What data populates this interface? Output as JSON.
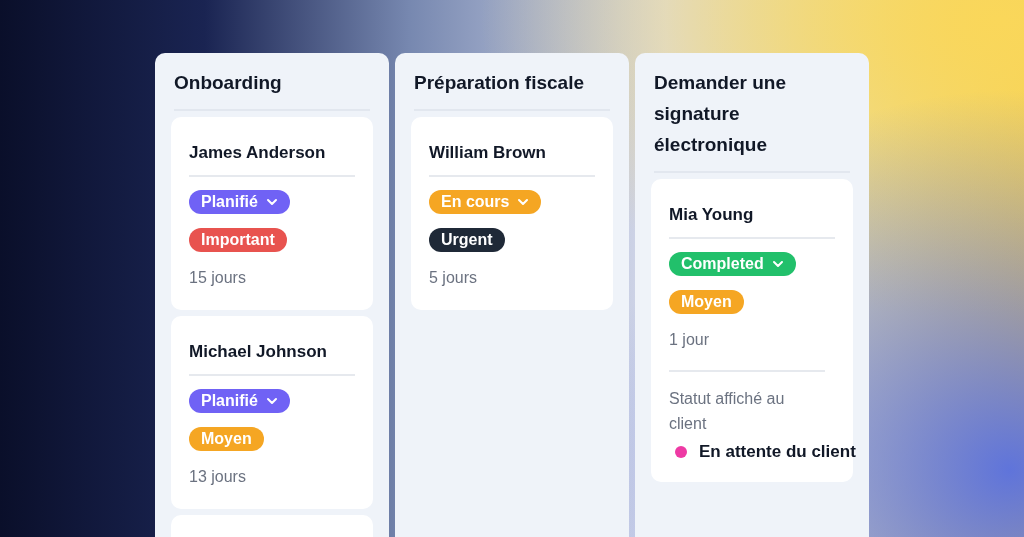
{
  "columns": [
    {
      "title": "Onboarding",
      "cards": [
        {
          "kind": "full",
          "name": "James Anderson",
          "status": {
            "label": "Planifié",
            "color": "#7062f5"
          },
          "priority": {
            "label": "Important",
            "color": "#e8534f"
          },
          "duration": "15 jours"
        },
        {
          "kind": "full",
          "name": "Michael Johnson",
          "status": {
            "label": "Planifié",
            "color": "#7062f5"
          },
          "priority": {
            "label": "Moyen",
            "color": "#f5a623"
          },
          "duration": "13 jours"
        },
        {
          "kind": "cut-off"
        }
      ]
    },
    {
      "title": "Préparation fiscale",
      "cards": [
        {
          "kind": "full",
          "name": "William Brown",
          "status": {
            "label": "En cours",
            "color": "#f5a623"
          },
          "priority": {
            "label": "Urgent",
            "color": "#1f2937"
          },
          "duration": "5 jours"
        }
      ]
    },
    {
      "title": "Demander une signature électronique",
      "cards": [
        {
          "kind": "full",
          "name": "Mia Young",
          "status": {
            "label": "Completed",
            "color": "#22c06b"
          },
          "priority": {
            "label": "Moyen",
            "color": "#f5a623"
          },
          "duration": "1 jour",
          "client_status": {
            "label": "Statut affiché au client",
            "value": "En attente du client",
            "color": "#ee3aa4"
          }
        }
      ]
    }
  ]
}
